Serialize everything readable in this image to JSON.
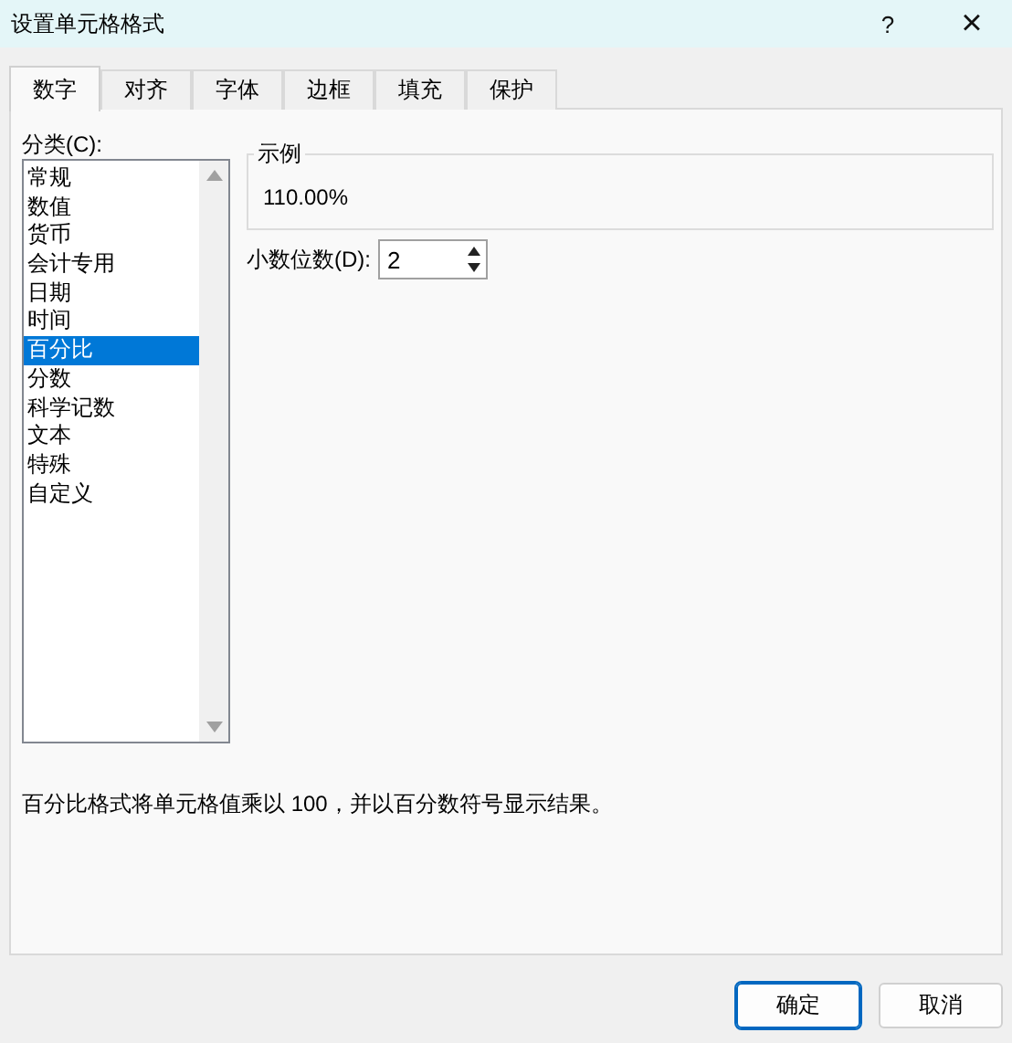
{
  "window": {
    "title": "设置单元格格式",
    "help": "?",
    "close": "×"
  },
  "tabs": [
    {
      "label": "数字",
      "selected": true
    },
    {
      "label": "对齐",
      "selected": false
    },
    {
      "label": "字体",
      "selected": false
    },
    {
      "label": "边框",
      "selected": false
    },
    {
      "label": "填充",
      "selected": false
    },
    {
      "label": "保护",
      "selected": false
    }
  ],
  "category": {
    "label": "分类(C):",
    "items": [
      {
        "label": "常规",
        "selected": false
      },
      {
        "label": "数值",
        "selected": false
      },
      {
        "label": "货币",
        "selected": false
      },
      {
        "label": "会计专用",
        "selected": false
      },
      {
        "label": "日期",
        "selected": false
      },
      {
        "label": "时间",
        "selected": false
      },
      {
        "label": "百分比",
        "selected": true
      },
      {
        "label": "分数",
        "selected": false
      },
      {
        "label": "科学记数",
        "selected": false
      },
      {
        "label": "文本",
        "selected": false
      },
      {
        "label": "特殊",
        "selected": false
      },
      {
        "label": "自定义",
        "selected": false
      }
    ]
  },
  "sample": {
    "label": "示例",
    "value": "110.00%"
  },
  "decimal_places": {
    "label": "小数位数(D):",
    "value": "2"
  },
  "description": "百分比格式将单元格值乘以 100，并以百分数符号显示结果。",
  "buttons": [
    {
      "label": "确定",
      "kind": "default"
    },
    {
      "label": "取消",
      "kind": "normal"
    }
  ]
}
